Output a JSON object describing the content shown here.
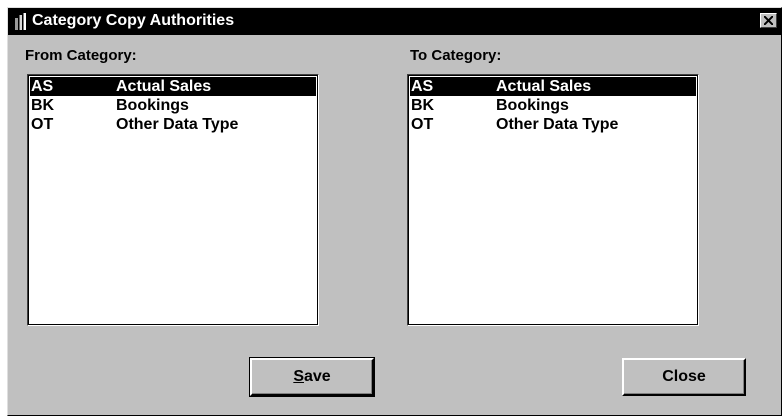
{
  "window": {
    "title": "Category Copy Authorities"
  },
  "from_category": {
    "label": "From Category:",
    "items": [
      {
        "code": "AS",
        "description": "Actual Sales",
        "selected": true
      },
      {
        "code": "BK",
        "description": "Bookings",
        "selected": false
      },
      {
        "code": "OT",
        "description": "Other Data Type",
        "selected": false
      }
    ]
  },
  "to_category": {
    "label": "To Category:",
    "items": [
      {
        "code": "AS",
        "description": "Actual Sales",
        "selected": true
      },
      {
        "code": "BK",
        "description": "Bookings",
        "selected": false
      },
      {
        "code": "OT",
        "description": "Other Data Type",
        "selected": false
      }
    ]
  },
  "buttons": {
    "save_mnemonic": "S",
    "save_rest": "ave",
    "close": "Close"
  },
  "icons": {
    "app": "bookshelf-icon",
    "close": "close-icon"
  }
}
